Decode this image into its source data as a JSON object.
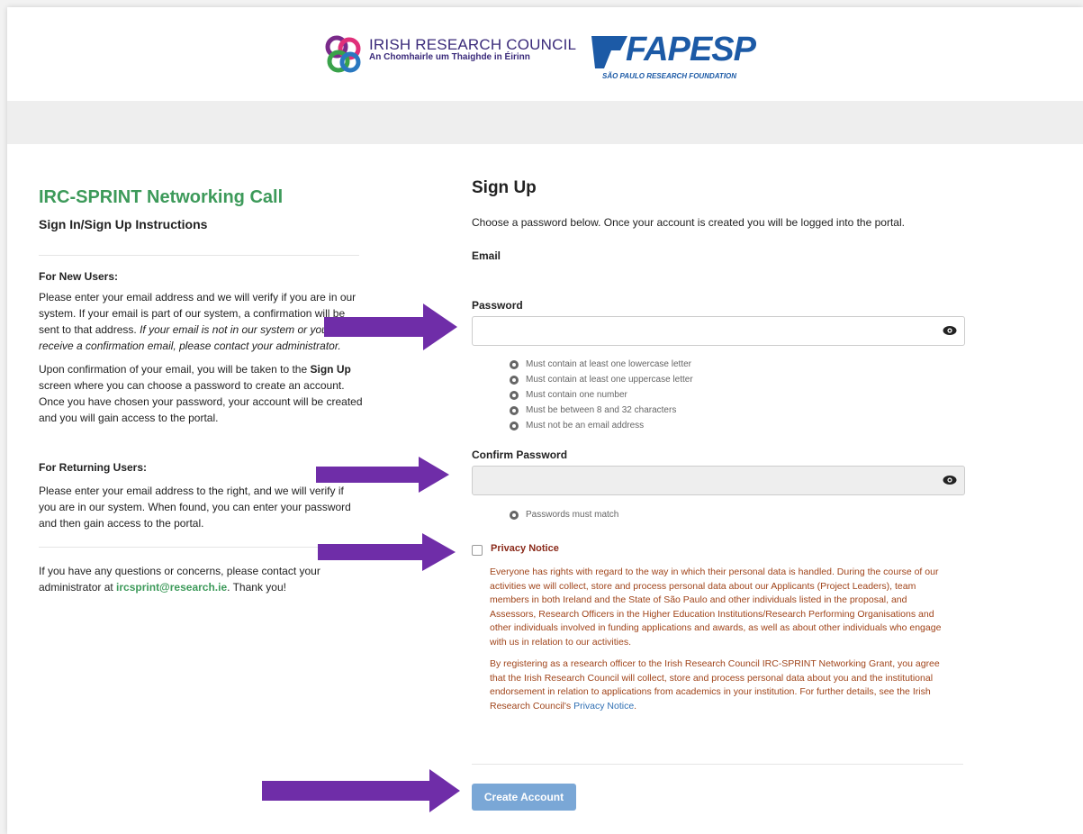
{
  "header": {
    "irc_logo": {
      "name": "IRISH RESEARCH COUNCIL",
      "subtitle": "An Chomhairle um Thaighde in Éirinn"
    },
    "fapesp_logo": {
      "name": "FAPESP",
      "subtitle": "SÃO PAULO RESEARCH FOUNDATION"
    }
  },
  "left": {
    "title": "IRC-SPRINT Networking Call",
    "subtitle": "Sign In/Sign Up Instructions",
    "new_users": {
      "heading": "For New Users:",
      "para1_a": "Please enter your email address and we will verify if you are in our system. If your email is part of our system, a confirmation will be sent to that address.",
      "para1_b": "If your email is not in our system or you do not receive a confirmation email, please contact your administrator.",
      "para2_a": "Upon confirmation of your email, you will be taken to the",
      "para2_bold": "Sign Up",
      "para2_b": "screen where you can choose a password to create an account. Once you have chosen your password, your account will be created and you will gain access to the portal."
    },
    "returning_users": {
      "heading": "For Returning Users:",
      "para": "Please enter your email address to the right, and we will verify if you are in our system. When found, you can enter your password and then gain access to the portal."
    },
    "contact_a": "If you have any questions or concerns, please contact your administrator at",
    "contact_email": "ircsprint@research.ie",
    "contact_b": ". Thank you!"
  },
  "form": {
    "title": "Sign Up",
    "intro": "Choose a password below. Once your account is created you will be logged into the portal.",
    "email_label": "Email",
    "password_label": "Password",
    "password_value": "",
    "password_rules": [
      "Must contain at least one lowercase letter",
      "Must contain at least one uppercase letter",
      "Must contain one number",
      "Must be between 8 and 32 characters",
      "Must not be an email address"
    ],
    "confirm_label": "Confirm Password",
    "confirm_value": "",
    "confirm_rules": [
      "Passwords must match"
    ],
    "privacy_label": "Privacy Notice",
    "privacy_checked": false,
    "privacy_p1": "Everyone has rights with regard to the way in which their personal data is handled. During the course of our activities we will collect, store and process personal data about our Applicants (Project Leaders), team members in both Ireland and the State of São Paulo and other individuals listed in the proposal, and Assessors, Research Officers in the Higher Education Institutions/Research Performing Organisations and other individuals involved in funding applications and awards, as well as about other individuals who engage with us in relation to our activities.",
    "privacy_p2_a": "By registering as a research officer to the Irish Research Council IRC-SPRINT Networking Grant, you agree that the Irish Research Council will collect, store and process personal data about you and the institutional endorsement in relation to applications from academics in your institution. For further details, see the Irish Research Council's",
    "privacy_link": "Privacy Notice",
    "privacy_p2_b": ".",
    "submit_label": "Create Account"
  },
  "colors": {
    "accent_green": "#3d9a5a",
    "arrow_purple": "#6f2da8",
    "button_blue": "#7aa7d6",
    "privacy_text": "#a0441a"
  }
}
